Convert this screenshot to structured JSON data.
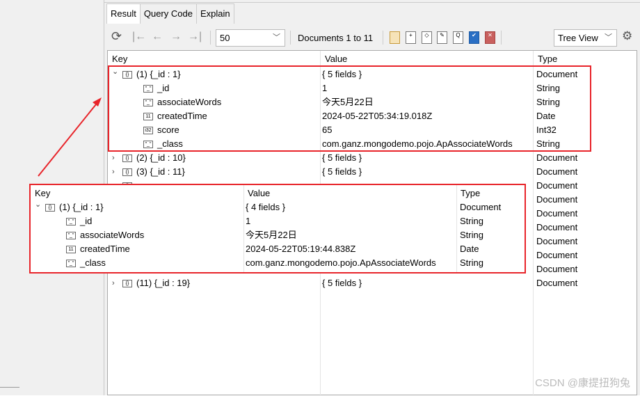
{
  "tabs": [
    "Result",
    "Query Code",
    "Explain"
  ],
  "toolbar": {
    "page_size": "50",
    "documents_label": "Documents 1 to 11",
    "view_mode": "Tree View"
  },
  "columns": {
    "key": "Key",
    "value": "Value",
    "type": "Type"
  },
  "rows": [
    {
      "expander": "v",
      "icon": "{}",
      "key": "(1) {_id : 1}",
      "value": "{ 5 fields }",
      "type": "Document",
      "indent": 0
    },
    {
      "expander": "",
      "icon": "\"_\"",
      "key": "_id",
      "value": "1",
      "type": "String",
      "indent": 1
    },
    {
      "expander": "",
      "icon": "\"_\"",
      "key": "associateWords",
      "value": "今天5月22日",
      "type": "String",
      "indent": 1
    },
    {
      "expander": "",
      "icon": "11",
      "key": "createdTime",
      "value": "2024-05-22T05:34:19.018Z",
      "type": "Date",
      "indent": 1
    },
    {
      "expander": "",
      "icon": "i32",
      "key": "score",
      "value": "65",
      "type": "Int32",
      "indent": 1
    },
    {
      "expander": "",
      "icon": "\"_\"",
      "key": "_class",
      "value": "com.ganz.mongodemo.pojo.ApAssociateWords",
      "type": "String",
      "indent": 1
    },
    {
      "expander": ">",
      "icon": "{}",
      "key": "(2) {_id : 10}",
      "value": "{ 5 fields }",
      "type": "Document",
      "indent": 0
    },
    {
      "expander": ">",
      "icon": "{}",
      "key": "(3) {_id : 11}",
      "value": "{ 5 fields }",
      "type": "Document",
      "indent": 0
    },
    {
      "expander": ">",
      "icon": "{}",
      "key": "",
      "value": "",
      "type": "Document",
      "indent": 0
    },
    {
      "expander": ">",
      "icon": "{}",
      "key": "",
      "value": "",
      "type": "Document",
      "indent": 0
    },
    {
      "expander": ">",
      "icon": "{}",
      "key": "",
      "value": "",
      "type": "Document",
      "indent": 0
    },
    {
      "expander": ">",
      "icon": "{}",
      "key": "",
      "value": "",
      "type": "Document",
      "indent": 0
    },
    {
      "expander": ">",
      "icon": "{}",
      "key": "",
      "value": "",
      "type": "Document",
      "indent": 0
    },
    {
      "expander": ">",
      "icon": "{}",
      "key": "",
      "value": "",
      "type": "Document",
      "indent": 0
    },
    {
      "expander": ">",
      "icon": "{}",
      "key": "",
      "value": "",
      "type": "Document",
      "indent": 0
    },
    {
      "expander": ">",
      "icon": "{}",
      "key": "(11) {_id : 19}",
      "value": "{ 5 fields }",
      "type": "Document",
      "indent": 0
    }
  ],
  "overlay": {
    "columns": {
      "key": "Key",
      "value": "Value",
      "type": "Type"
    },
    "rows": [
      {
        "expander": "v",
        "icon": "{}",
        "key": "(1) {_id : 1}",
        "value": "{ 4 fields }",
        "type": "Document",
        "indent": 0
      },
      {
        "expander": "",
        "icon": "\"_\"",
        "key": "_id",
        "value": "1",
        "type": "String",
        "indent": 1
      },
      {
        "expander": "",
        "icon": "\"_\"",
        "key": "associateWords",
        "value": "今天5月22日",
        "type": "String",
        "indent": 1
      },
      {
        "expander": "",
        "icon": "11",
        "key": "createdTime",
        "value": "2024-05-22T05:19:44.838Z",
        "type": "Date",
        "indent": 1
      },
      {
        "expander": "",
        "icon": "\"_\"",
        "key": "_class",
        "value": "com.ganz.mongodemo.pojo.ApAssociateWords",
        "type": "String",
        "indent": 1
      }
    ]
  },
  "watermark": "CSDN @康提扭狗兔",
  "colors": {
    "highlight": "#e8242a"
  }
}
